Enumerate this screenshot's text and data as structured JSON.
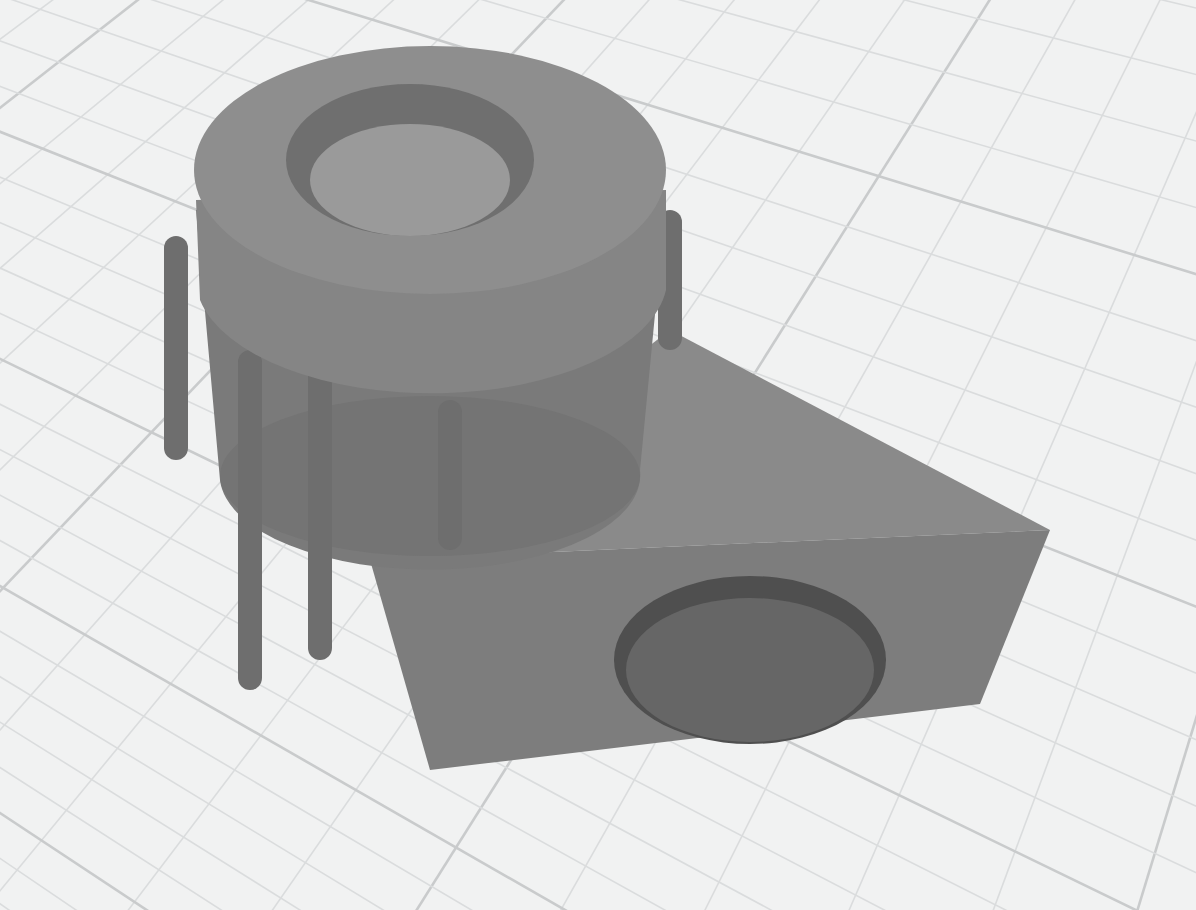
{
  "workplane": {
    "grid_visible": true
  },
  "model": {
    "kind": "knob-bracket"
  }
}
